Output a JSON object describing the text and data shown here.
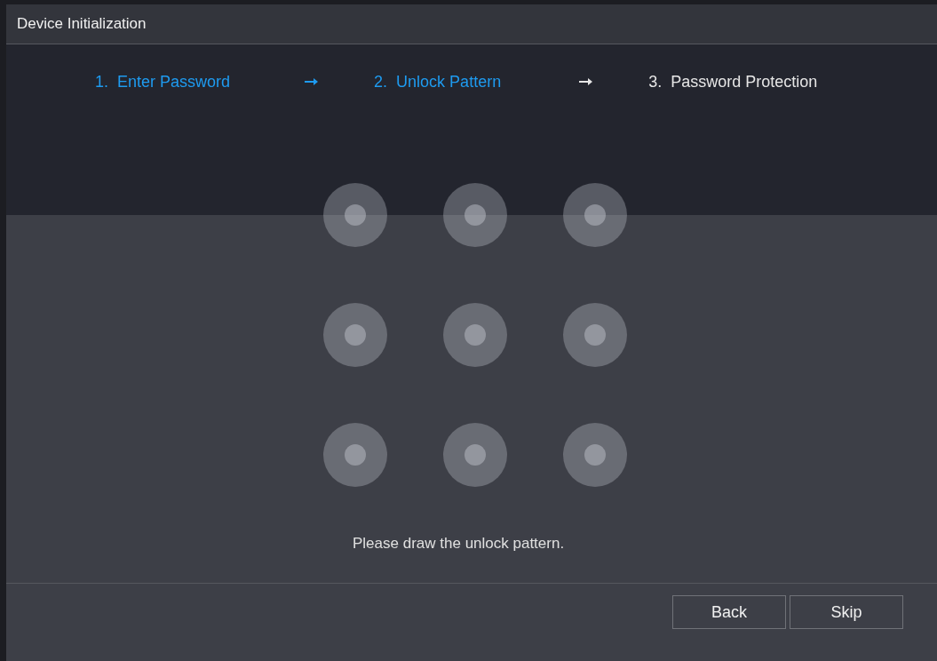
{
  "window": {
    "title": "Device Initialization"
  },
  "steps": [
    {
      "number": "1.",
      "label": "Enter Password",
      "active": true
    },
    {
      "number": "2.",
      "label": "Unlock Pattern",
      "active": true
    },
    {
      "number": "3.",
      "label": "Password Protection",
      "active": false
    }
  ],
  "message": "Please draw the unlock pattern.",
  "buttons": [
    "Back",
    "Skip"
  ]
}
